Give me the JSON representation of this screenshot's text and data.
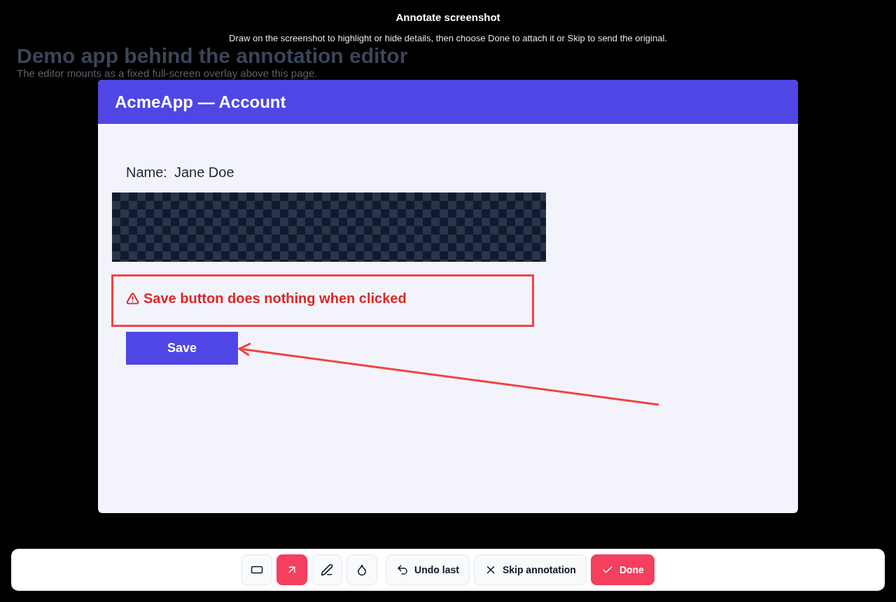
{
  "background_page": {
    "heading": "Demo app behind the annotation editor",
    "text": "The editor mounts as a fixed full-screen overlay above this page."
  },
  "overlay": {
    "title": "Annotate screenshot",
    "subtitle": "Draw on the screenshot to highlight or hide details, then choose Done to attach it or Skip to send the original."
  },
  "screenshot": {
    "app_title": "AcmeApp — Account",
    "name_label": "Name:",
    "name_value": "Jane Doe",
    "warning": "Save button does nothing when clicked",
    "save_button": "Save",
    "annotations": [
      {
        "kind": "redaction"
      },
      {
        "kind": "rectangle"
      },
      {
        "kind": "arrow"
      }
    ]
  },
  "toolbar": {
    "tools": [
      {
        "kind": "rectangle",
        "selected": false
      },
      {
        "kind": "arrow",
        "selected": true
      },
      {
        "kind": "pen",
        "selected": false
      },
      {
        "kind": "blur",
        "selected": false
      }
    ],
    "actions": [
      {
        "kind": "undo",
        "label": "Undo last"
      },
      {
        "kind": "skip",
        "label": "Skip annotation"
      },
      {
        "kind": "done",
        "label": "Done"
      }
    ]
  }
}
